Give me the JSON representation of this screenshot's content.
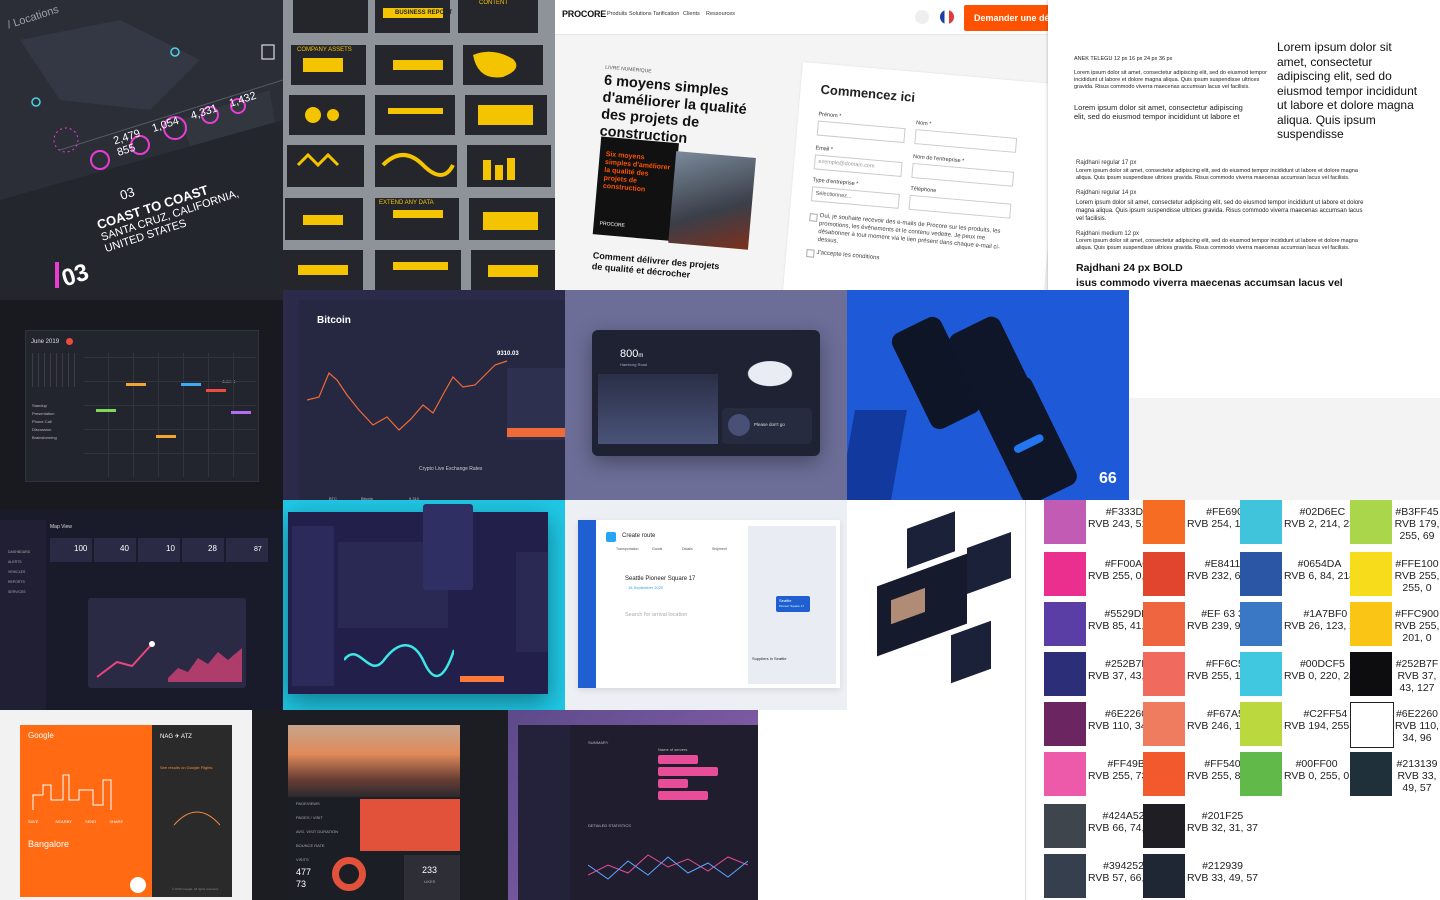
{
  "travel_map": {
    "title": "/ Locations",
    "stats": [
      "2,479",
      "1,054",
      "4,331",
      "1,432",
      "855"
    ],
    "pill": "03",
    "heading": "COAST TO COAST",
    "subheading": "SANTA CRUZ, CALIFORNIA, UNITED STATES",
    "big_number": "03",
    "colors": {
      "accent": "#e83dd1",
      "bg": "#2a2d36"
    }
  },
  "slides": {
    "report_title": "BUSINESS REPORT",
    "assets": "COMPANY ASSETS",
    "content": "CONTENT",
    "extend": "EXTEND ANY DATA",
    "accent": "#f5c400"
  },
  "procore": {
    "logo": "PROCORE",
    "nav": [
      "Produits",
      "Solutions",
      "Tarification",
      "Clients",
      "Ressources"
    ],
    "cta": "Demander une dé",
    "eyebrow": "LIVRE NUMÉRIQUE",
    "headline": "6 moyens simples d'améliorer la qualité des projets de construction",
    "cover_text": "Six moyens simples d'améliorer la qualité des projets de construction",
    "cover_logo": "PROCORE",
    "bottom_text": "Comment délivrer des projets de qualité et décrocher",
    "form_title": "Commencez ici",
    "fields": {
      "prenom": "Prénom *",
      "nom": "Nom *",
      "email": "Email *",
      "email_placeholder": "exemple@domain.com",
      "entreprise": "Nom de l'entreprise *",
      "type": "Type d'entreprise *",
      "type_value": "Sélectionnez...",
      "telephone": "Téléphone"
    },
    "consent1": "Oui, je souhaite recevoir des e-mails de Procore sur les produits, les promotions, les événements et le contenu vedette. Je peux me désabonner à tout moment via le lien présent dans chaque e-mail ci-dessus.",
    "consent2": "J'accepte les conditions",
    "accent": "#ff5200"
  },
  "typography": {
    "label_anek": "ANEK TELEGU 12 px 16 px 24 px 36 px",
    "lorem_short": "Lorem ipsum dolor sit amet, consectetur adipiscing elit, sed do eiusmod tempor incididunt ut labore et dolore magna aliqua. Quis ipsum suspendisse ultrices gravida. Risus commodo viverra maecenas accumsan lacus vel facilisis.",
    "lorem_mid": "Lorem ipsum dolor sit amet, consectetur adipiscing elit, sed do eiusmod tempor incididunt ut labore et",
    "lorem_big": "Lorem ipsum dolor sit amet, consectetur adipiscing elit, sed do eiusmod tempor incididunt ut labore et dolore magna aliqua. Quis ipsum suspendisse",
    "label_17": "Rajdhani regular 17 px",
    "label_14": "Rajdhani regular 14 px",
    "label_12": "Rajdhani medium 12 px",
    "lorem_full": "Lorem ipsum dolor sit amet, consectetur adipiscing elit, sed do eiusmod tempor incididunt ut labore et dolore magna aliqua. Quis ipsum suspendisse ultrices gravida. Risus commodo viverra maecenas accumsan lacus vel facilisis.",
    "bold_title": "Rajdhani 24 px BOLD",
    "bold_body": "isus commodo viverra maecenas accumsan lacus vel facilisis."
  },
  "calendar": {
    "month": "June 2019",
    "view_month": "June 1",
    "weekdays": [
      "Sun",
      "Mon",
      "Tue",
      "Wed",
      "Thu",
      "Fri",
      "Sat"
    ],
    "events": [
      "Standup",
      "Presentation",
      "Phone Call",
      "Discussion",
      "Brainstorming"
    ]
  },
  "bitcoin": {
    "title": "Bitcoin",
    "price": "9310.03",
    "footer": "Crypto Live Exchange Rates",
    "row": [
      "BTC",
      "Bitcoin",
      "9,310"
    ]
  },
  "car": {
    "distance": "800",
    "unit": "m",
    "street": "Hamburg Road",
    "music": "Please don't go"
  },
  "mobile": {
    "badge": "66"
  },
  "map_view": {
    "title": "Map View",
    "stats": [
      "100",
      "40",
      "10",
      "28",
      "87"
    ],
    "nav": [
      "DASHBOARD",
      "ALERTS",
      "VEHICLES",
      "REPORTS",
      "SERVICES"
    ]
  },
  "route": {
    "title": "Create route",
    "stop1": "Seattle Pioneer Square 17",
    "date1": "18 September 2020",
    "stop2": "Search for arrival location",
    "map_label": "Seattle",
    "map_sub": "Pioneer Square 17",
    "suppliers": "Suppliers in Seattle",
    "tabs": [
      "Transportation",
      "Goods",
      "Details",
      "Shipment"
    ]
  },
  "palette": [
    [
      {
        "hex": "#F333DE",
        "rgb": "RVB 243, 51,222",
        "color": "#c25bb3"
      },
      {
        "hex": "#FE690D",
        "rgb": "RVB 254, 105, 13",
        "color": "#f56c22"
      },
      {
        "hex": "#02D6EC",
        "rgb": "RVB 2, 214, 236",
        "color": "#40c4dc"
      },
      {
        "hex": "#B3FF45",
        "rgb": "RVB 179, 255, 69",
        "color": "#a9d64a"
      }
    ],
    [
      {
        "hex": "#FF00A6",
        "rgb": "RVB 255, 0, 166",
        "color": "#ea2f8e"
      },
      {
        "hex": "#E84114",
        "rgb": "RVB 232, 65, 20",
        "color": "#e2452e"
      },
      {
        "hex": "#0654DA",
        "rgb": "RVB 6, 84, 218",
        "color": "#2b56a6"
      },
      {
        "hex": "#FFE100",
        "rgb": "RVB 255, 255, 0",
        "color": "#f7dc1c"
      }
    ],
    [
      {
        "hex": "#5529DE",
        "rgb": "RVB 85, 41, 222",
        "color": "#5a3ea5"
      },
      {
        "hex": "#EF 63 32",
        "rgb": "RVB 239, 99, 50",
        "color": "#ee653f"
      },
      {
        "hex": "#1A7BF0",
        "rgb": "RVB 26, 123, 240",
        "color": "#3a78c6"
      },
      {
        "hex": "#FFC900",
        "rgb": "RVB 255, 201, 0",
        "color": "#fbc515"
      }
    ],
    [
      {
        "hex": "#252B7F",
        "rgb": "RVB 37, 43, 127",
        "color": "#2c2f78"
      },
      {
        "hex": "#FF6C5A",
        "rgb": "RVB 255, 108, 90",
        "color": "#f06b5e"
      },
      {
        "hex": "#00DCF5",
        "rgb": "RVB 0, 220, 245",
        "color": "#3fc8df"
      },
      {
        "hex": "#252B7F",
        "rgb": "RVB 37, 43, 127",
        "color": "#0d0d10"
      }
    ],
    [
      {
        "hex": "#6E2260",
        "rgb": "RVB 110, 34, 96",
        "color": "#6b2560"
      },
      {
        "hex": "#F67A56",
        "rgb": "RVB 246, 122, 86",
        "color": "#ef7c5f"
      },
      {
        "hex": "#C2FF54",
        "rgb": "RVB 194, 255, 84",
        "color": "#bcd83f"
      },
      {
        "hex": "#6E2260",
        "rgb": "RVB 110, 34, 96",
        "color": "#ffffff"
      }
    ],
    [
      {
        "hex": "#FF49BF",
        "rgb": "RVB 255, 73, 191",
        "color": "#ec5aa9"
      },
      {
        "hex": "#FF5400",
        "rgb": "RVB 255, 84, 00",
        "color": "#f2592c"
      },
      {
        "hex": "#00FF00",
        "rgb": "RVB 0, 255, 0",
        "color": "#61b94a"
      },
      {
        "hex": "#213139",
        "rgb": "RVB 33, 49, 57",
        "color": "#20303a"
      }
    ],
    [
      {
        "hex": "#424A52",
        "rgb": "RVB 66, 74, 82",
        "color": "#3e454d"
      },
      {
        "hex": "#201F25",
        "rgb": "RVB 32, 31, 37",
        "color": "#1f1e24"
      }
    ],
    [
      {
        "hex": "#394252",
        "rgb": "RVB 57, 66, 82",
        "color": "#363f4d"
      },
      {
        "hex": "#212939",
        "rgb": "RVB 33, 49, 57",
        "color": "#1f2735"
      }
    ]
  ],
  "google": {
    "brand": "Google",
    "city": "Bangalore",
    "route": "NAG ✈ ATZ",
    "link": "See results on Google Flights",
    "tags": [
      "SAVE",
      "NEARBY",
      "SEND",
      "SHARE"
    ],
    "footer": "© 2016 Google. All rights reserved."
  },
  "photo_stats": {
    "labels": [
      "PAGEVIEWS",
      "PAGES / VISIT",
      "AVG. VISIT DURATION",
      "BOUNCE RATE",
      "VISITS"
    ],
    "values": [
      "477",
      "73",
      "233"
    ],
    "likes": "LIKES"
  },
  "analytics": {
    "summary": "SUMMARY",
    "section": "Name of servers",
    "stats": "DETAILED STATISTICS"
  }
}
